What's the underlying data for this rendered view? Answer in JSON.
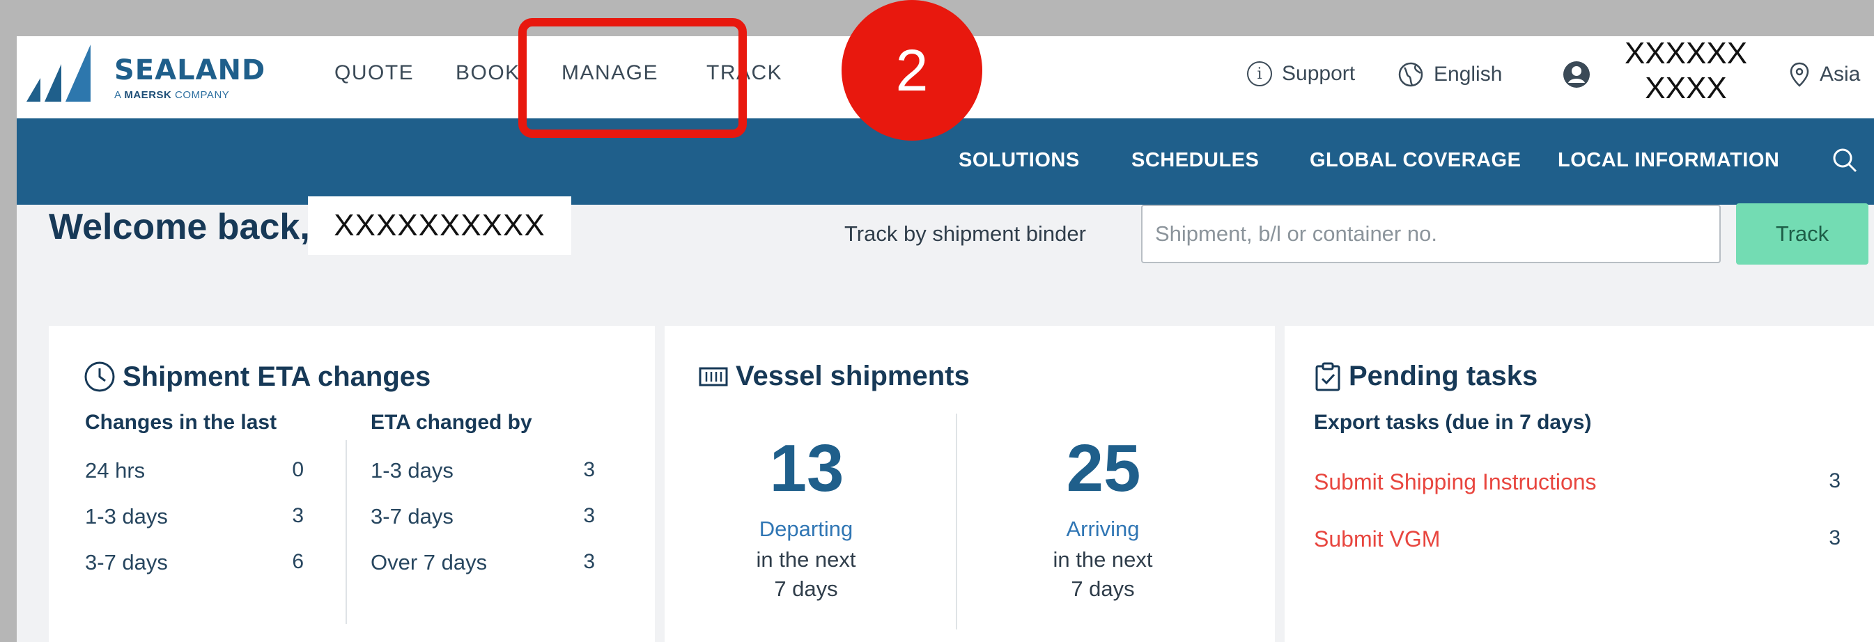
{
  "brand": {
    "name": "SEALAND",
    "sub_prefix": "A",
    "sub_maersk": "MAERSK",
    "sub_suffix": "COMPANY"
  },
  "nav": {
    "quote": "QUOTE",
    "book": "BOOK",
    "manage": "MANAGE",
    "track": "TRACK"
  },
  "utility": {
    "support": "Support",
    "language": "English",
    "user_line1": "XXXXXX",
    "user_line2": "XXXX",
    "region": "Asia"
  },
  "subnav": {
    "solutions": "SOLUTIONS",
    "schedules": "SCHEDULES",
    "global_coverage": "GLOBAL COVERAGE",
    "local_information": "LOCAL INFORMATION"
  },
  "welcome": {
    "greeting": "Welcome back,",
    "name": "XXXXXXXXXX"
  },
  "tracking": {
    "label": "Track by shipment binder",
    "placeholder": "Shipment, b/l or container no.",
    "button": "Track"
  },
  "eta_card": {
    "title": "Shipment ETA changes",
    "col1_header": "Changes in the last",
    "col2_header": "ETA changed by",
    "col1_rows": [
      {
        "label": "24 hrs",
        "count": "0"
      },
      {
        "label": "1-3 days",
        "count": "3"
      },
      {
        "label": "3-7 days",
        "count": "6"
      }
    ],
    "col2_rows": [
      {
        "label": "1-3 days",
        "count": "3"
      },
      {
        "label": "3-7 days",
        "count": "3"
      },
      {
        "label": "Over 7 days",
        "count": "3"
      }
    ]
  },
  "vessel_card": {
    "title": "Vessel shipments",
    "departing": {
      "count": "13",
      "label": "Departing",
      "line2": "in the next",
      "line3": "7 days"
    },
    "arriving": {
      "count": "25",
      "label": "Arriving",
      "line2": "in the next",
      "line3": "7 days"
    }
  },
  "tasks_card": {
    "title": "Pending tasks",
    "subtitle": "Export tasks (due in 7 days)",
    "items": [
      {
        "label": "Submit Shipping Instructions",
        "count": "3"
      },
      {
        "label": "Submit VGM",
        "count": "3"
      }
    ]
  },
  "annotation": {
    "step": "2",
    "color": "#e8180e"
  },
  "colors": {
    "brand_blue": "#1f5f8b",
    "track_button": "#73dcb3",
    "task_red": "#e8463f"
  }
}
